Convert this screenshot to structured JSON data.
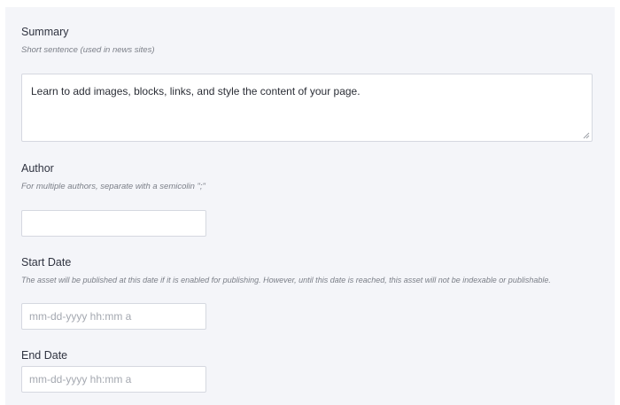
{
  "summary": {
    "label": "Summary",
    "help": "Short sentence (used in news sites)",
    "value": "Learn to add images, blocks, links, and style the content of your page."
  },
  "author": {
    "label": "Author",
    "help": "For multiple authors, separate with a semicolin \";\"",
    "value": ""
  },
  "start_date": {
    "label": "Start Date",
    "help": "The asset will be published at this date if it is enabled for publishing. However, until this date is reached, this asset will not be indexable or publishable.",
    "placeholder": "mm-dd-yyyy hh:mm a"
  },
  "end_date": {
    "label": "End Date",
    "placeholder": "mm-dd-yyyy hh:mm a"
  },
  "colors": {
    "panel_background": "#f4f5f9",
    "field_border": "#d5d8e0",
    "label_text": "#2f3340",
    "help_text": "#7b7f88",
    "placeholder_text": "#a4a8b0"
  }
}
